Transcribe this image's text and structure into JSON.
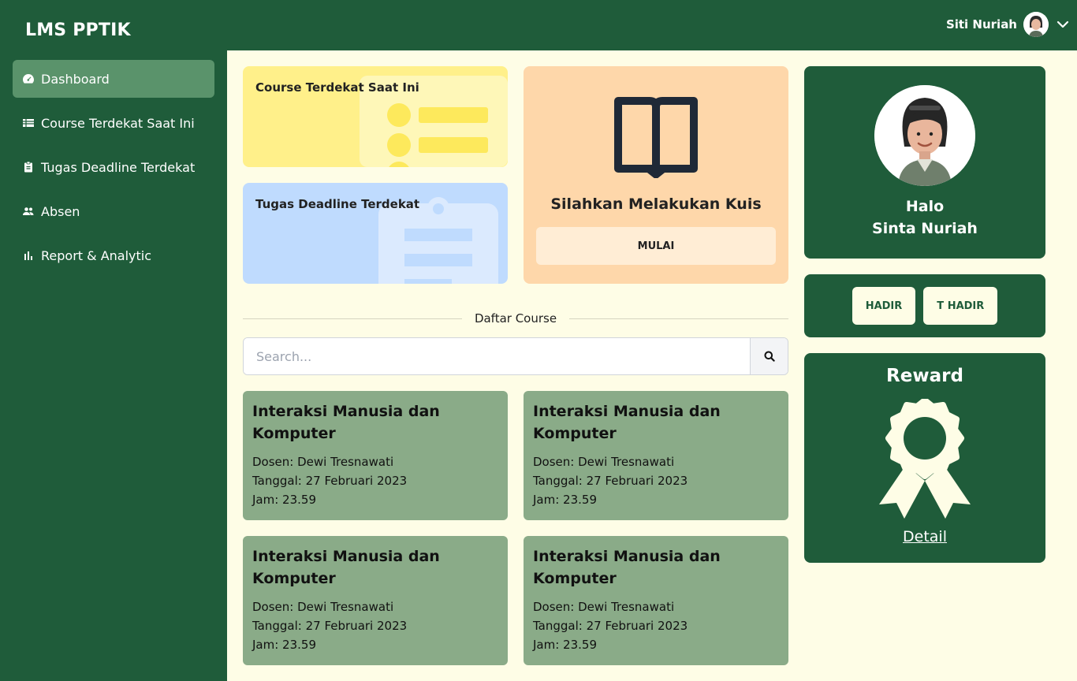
{
  "app": {
    "brand": "LMS PPTIK"
  },
  "header": {
    "user_name": "Siti Nuriah"
  },
  "sidebar": {
    "items": [
      {
        "label": "Dashboard",
        "icon": "dashboard-icon",
        "active": true
      },
      {
        "label": "Course Terdekat Saat Ini",
        "icon": "list-icon"
      },
      {
        "label": "Tugas Deadline Terdekat",
        "icon": "clipboard-icon"
      },
      {
        "label": "Absen",
        "icon": "people-icon"
      },
      {
        "label": "Report & Analytic",
        "icon": "bar-chart-icon"
      }
    ]
  },
  "cards": {
    "course_terdekat": "Course Terdekat Saat Ini",
    "tugas_deadline": "Tugas Deadline Terdekat"
  },
  "kuis": {
    "title": "Silahkan Melakukan Kuis",
    "button": "MULAI",
    "icon": "open-book-icon"
  },
  "course_section": {
    "label": "Daftar Course"
  },
  "search": {
    "placeholder": "Search...",
    "icon": "search-icon"
  },
  "courses": [
    {
      "title": "Interaksi Manusia dan Komputer",
      "dosen": "Dosen: Dewi Tresnawati",
      "tanggal": "Tanggal: 27 Februari 2023",
      "jam": "Jam: 23.59"
    },
    {
      "title": "Interaksi Manusia dan Komputer",
      "dosen": "Dosen: Dewi Tresnawati",
      "tanggal": "Tanggal: 27 Februari 2023",
      "jam": "Jam: 23.59"
    },
    {
      "title": "Interaksi Manusia dan Komputer",
      "dosen": "Dosen: Dewi Tresnawati",
      "tanggal": "Tanggal: 27 Februari 2023",
      "jam": "Jam: 23.59"
    },
    {
      "title": "Interaksi Manusia dan Komputer",
      "dosen": "Dosen: Dewi Tresnawati",
      "tanggal": "Tanggal: 27 Februari 2023",
      "jam": "Jam: 23.59"
    }
  ],
  "profile": {
    "greeting": "Halo",
    "name": "Sinta Nuriah"
  },
  "attendance": {
    "hadir": "HADIR",
    "tidak_hadir": "T HADIR"
  },
  "reward": {
    "title": "Reward",
    "link": "Detail",
    "icon": "award-ribbon-icon"
  },
  "colors": {
    "primary": "#1f5c3a",
    "background": "#fefde6",
    "course_card": "#8aab88",
    "yellow_card": "#fff08a",
    "blue_card": "#bfdbfe",
    "orange_card": "#fed7aa"
  }
}
